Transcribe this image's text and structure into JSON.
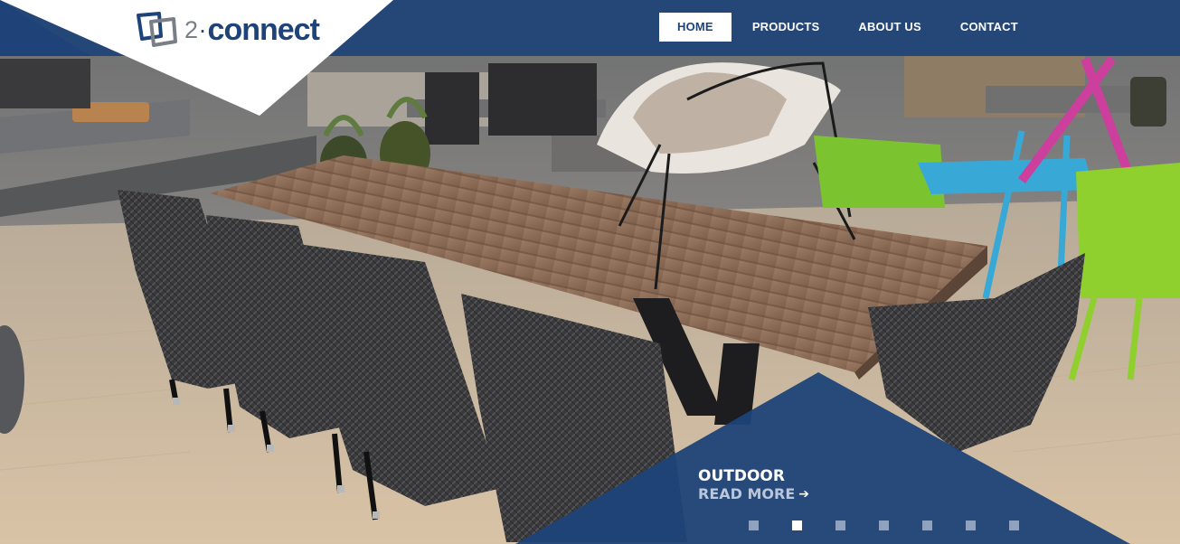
{
  "brand": {
    "prefix": "2",
    "separator": "·",
    "word": "connect"
  },
  "nav": {
    "items": [
      {
        "label": "HOME",
        "active": true
      },
      {
        "label": "PRODUCTS",
        "active": false
      },
      {
        "label": "ABOUT US",
        "active": false
      },
      {
        "label": "CONTACT",
        "active": false
      }
    ]
  },
  "slide": {
    "title": "OUTDOOR",
    "link_label": "READ MORE",
    "arrow_icon": "arrow-right-icon",
    "slide_count": 7,
    "current_slide": 2
  },
  "colors": {
    "brand_blue": "#1e4378",
    "indicator_inactive": "#8fa3c0",
    "indicator_active": "#ffffff"
  }
}
